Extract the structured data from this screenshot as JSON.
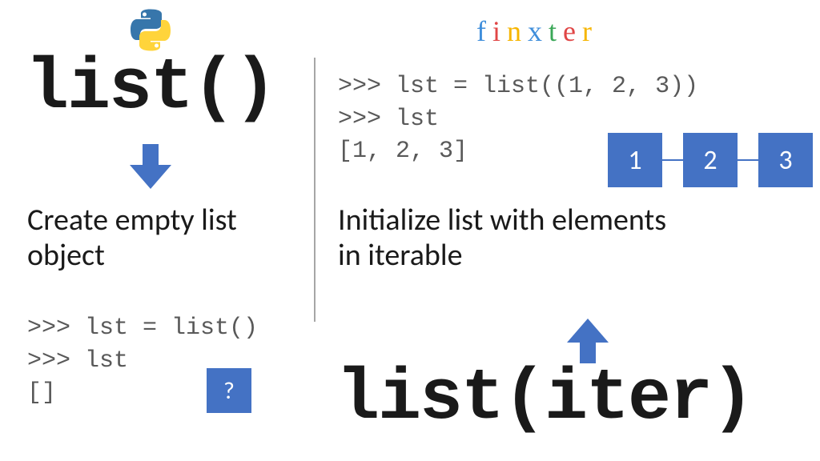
{
  "brand": {
    "letters": [
      "f",
      "i",
      "n",
      "x",
      "t",
      "e",
      "r"
    ]
  },
  "left": {
    "title": "list()",
    "description": "Create empty list object",
    "code": ">>> lst = list()\n>>> lst\n[]",
    "question_mark": "?"
  },
  "right": {
    "title": "list(iter)",
    "description": "Initialize list with elements in iterable",
    "code": ">>> lst = list((1, 2, 3))\n>>> lst\n[1, 2, 3]",
    "nodes": [
      "1",
      "2",
      "3"
    ]
  },
  "colors": {
    "accent": "#4472c4",
    "code_gray": "#595959"
  }
}
